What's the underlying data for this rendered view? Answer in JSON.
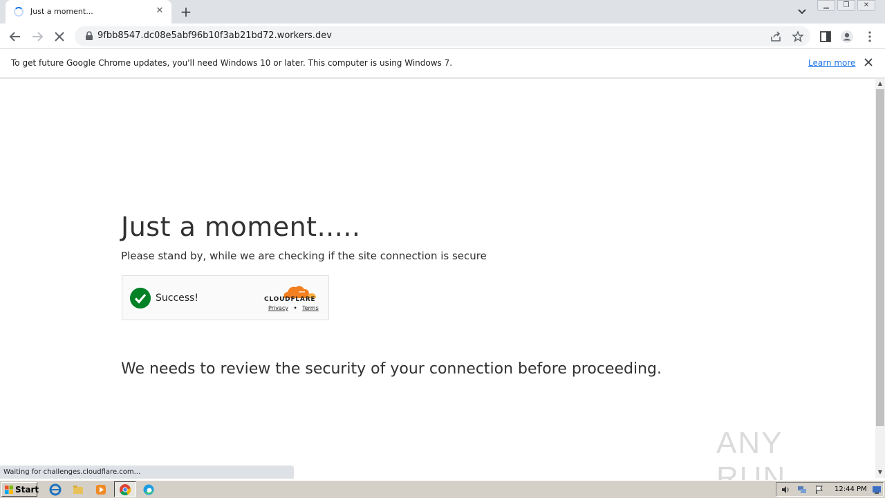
{
  "browser": {
    "tab": {
      "title": "Just a moment...",
      "state": "loading"
    },
    "url": "9fbb8547.dc08e5abf96b10f3ab21bd72.workers.dev",
    "infobar": {
      "text": "To get future Google Chrome updates, you'll need Windows 10 or later. This computer is using Windows 7.",
      "link": "Learn more"
    },
    "status_text": "Waiting for challenges.cloudflare.com..."
  },
  "page": {
    "heading": "Just a moment.....",
    "subheading": "Please stand by, while we are checking if the site connection is secure",
    "widget": {
      "status": "Success!",
      "brand": "CLOUDFLARE",
      "privacy": "Privacy",
      "separator": "•",
      "terms": "Terms"
    },
    "message": "We needs to review the security of your connection before proceeding."
  },
  "watermark": "ANY RUN",
  "taskbar": {
    "start_label": "Start",
    "clock": "12:44 PM",
    "quick_launch": [
      "ie-icon",
      "explorer-icon",
      "media-player-icon",
      "chrome-icon",
      "edge-icon"
    ]
  },
  "colors": {
    "success_green": "#038127",
    "cloudflare_orange": "#f38020",
    "link_blue": "#1a73e8"
  }
}
